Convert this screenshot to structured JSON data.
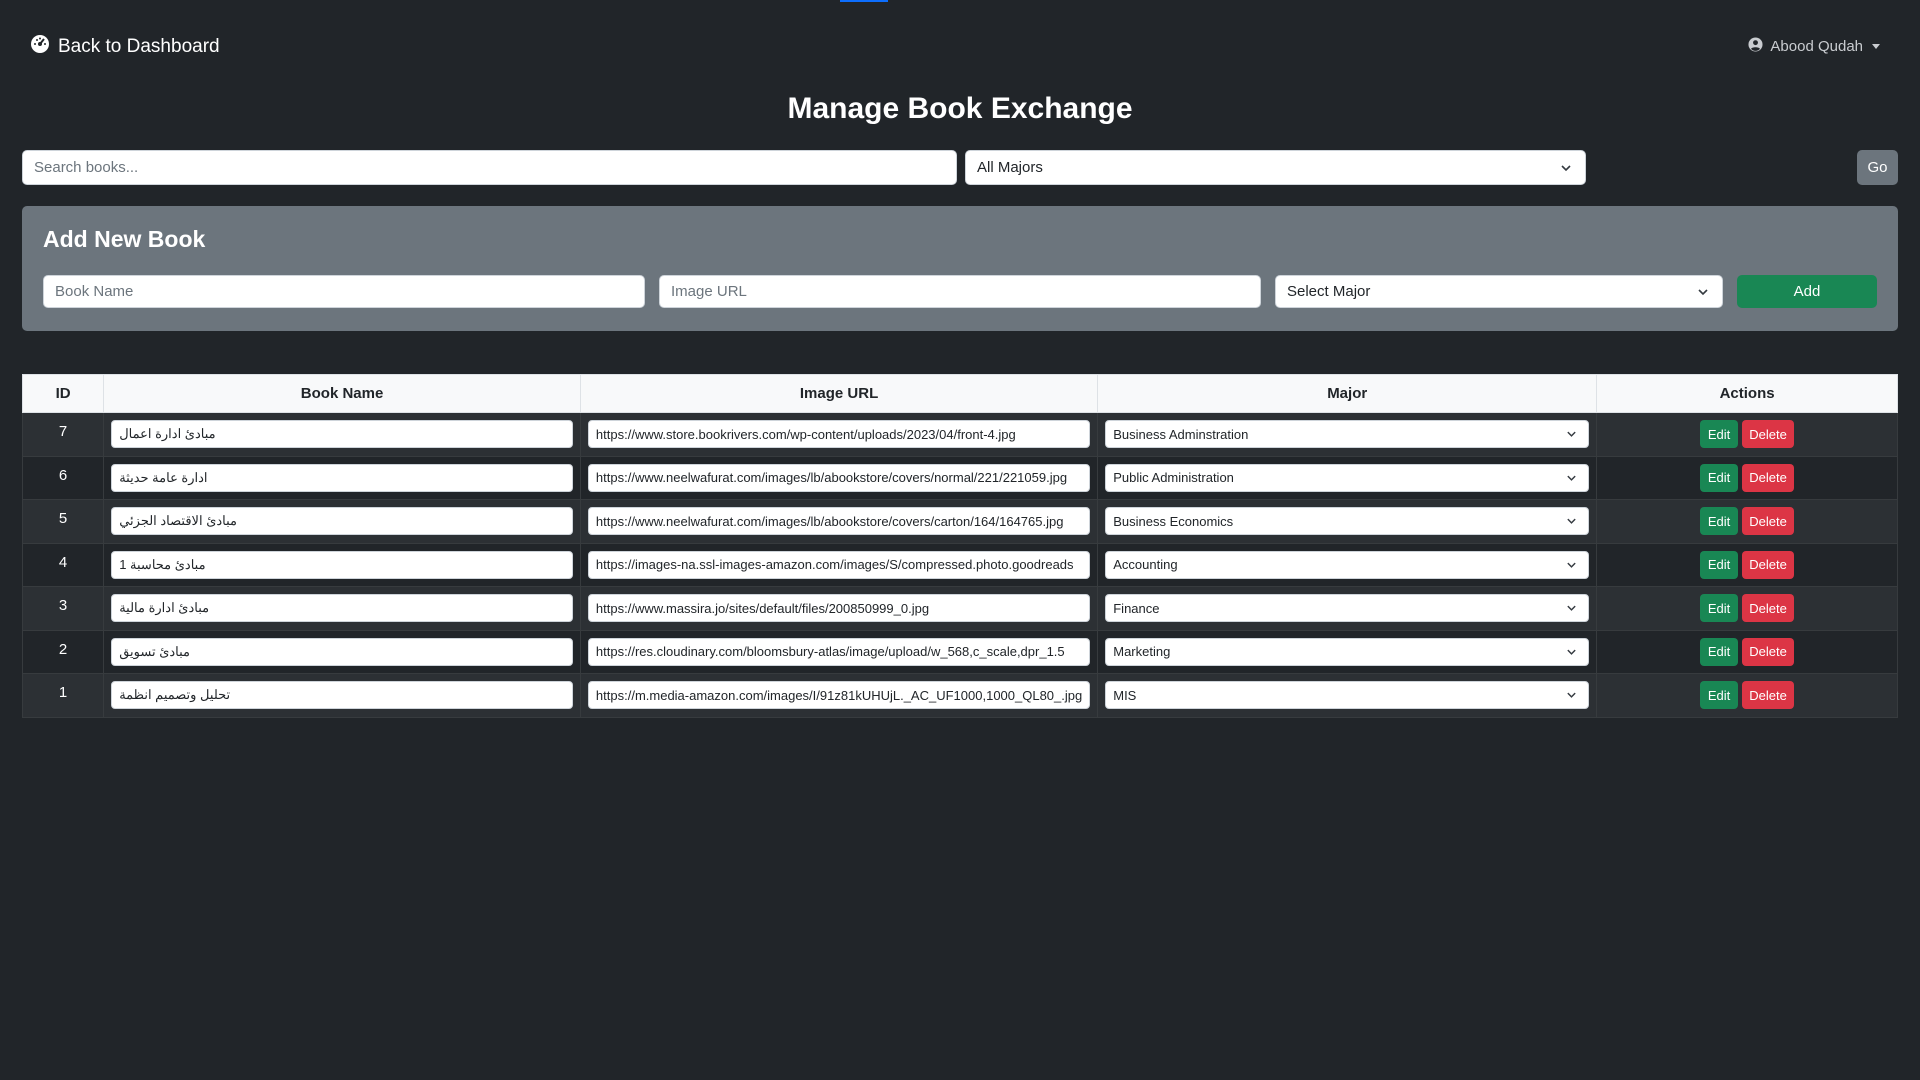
{
  "nav": {
    "back_label": "Back to Dashboard",
    "user_name": "Abood Qudah"
  },
  "page": {
    "title": "Manage Book Exchange"
  },
  "search": {
    "placeholder": "Search books...",
    "major_filter_value": "All Majors",
    "go_label": "Go"
  },
  "add_form": {
    "title": "Add New Book",
    "book_name_placeholder": "Book Name",
    "image_url_placeholder": "Image URL",
    "major_select_value": "Select Major",
    "add_label": "Add"
  },
  "table": {
    "headers": {
      "id": "ID",
      "book_name": "Book Name",
      "image_url": "Image URL",
      "major": "Major",
      "actions": "Actions"
    },
    "edit_label": "Edit",
    "delete_label": "Delete",
    "rows": [
      {
        "id": "7",
        "book_name": "مبادئ ادارة اعمال",
        "image_url": "https://www.store.bookrivers.com/wp-content/uploads/2023/04/front-4.jpg",
        "major": "Business Adminstration"
      },
      {
        "id": "6",
        "book_name": "ادارة عامة حديثة",
        "image_url": "https://www.neelwafurat.com/images/lb/abookstore/covers/normal/221/221059.jpg",
        "major": "Public Administration"
      },
      {
        "id": "5",
        "book_name": "مبادئ الاقتصاد الجزئي",
        "image_url": "https://www.neelwafurat.com/images/lb/abookstore/covers/carton/164/164765.jpg",
        "major": "Business Economics"
      },
      {
        "id": "4",
        "book_name": "مبادئ محاسبة 1",
        "image_url": "https://images-na.ssl-images-amazon.com/images/S/compressed.photo.goodreads",
        "major": "Accounting"
      },
      {
        "id": "3",
        "book_name": "مبادئ ادارة مالية",
        "image_url": "https://www.massira.jo/sites/default/files/200850999_0.jpg",
        "major": "Finance"
      },
      {
        "id": "2",
        "book_name": "مبادئ تسويق",
        "image_url": "https://res.cloudinary.com/bloomsbury-atlas/image/upload/w_568,c_scale,dpr_1.5",
        "major": "Marketing"
      },
      {
        "id": "1",
        "book_name": "تحليل وتصميم انظمة",
        "image_url": "https://m.media-amazon.com/images/I/91z81kUHUjL._AC_UF1000,1000_QL80_.jpg",
        "major": "MIS"
      }
    ]
  },
  "colors": {
    "background": "#212529",
    "card": "#6c757d",
    "success": "#198754",
    "danger": "#dc3545",
    "accent": "#0d6efd"
  }
}
